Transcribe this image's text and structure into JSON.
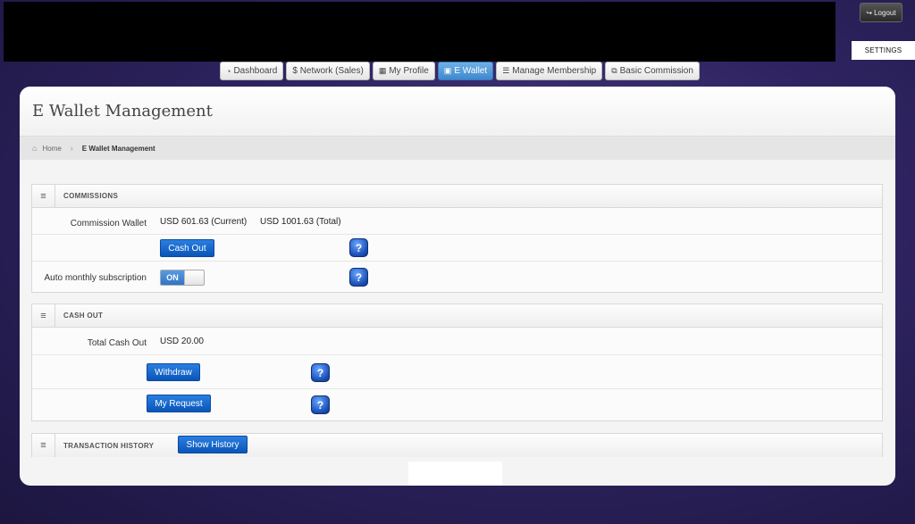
{
  "header": {
    "logout_label": "Logout",
    "settings_label": "SETTINGS"
  },
  "nav": {
    "tabs": [
      {
        "label": "Dashboard",
        "icon": "dashboard-icon"
      },
      {
        "label": "$ Network (Sales)",
        "icon": ""
      },
      {
        "label": "My Profile",
        "icon": "grid-icon"
      },
      {
        "label": "E Wallet",
        "icon": "wallet-icon",
        "active": true
      },
      {
        "label": "Manage Membership",
        "icon": "list-icon"
      },
      {
        "label": "Basic Commission",
        "icon": "external-link-icon"
      }
    ]
  },
  "page": {
    "title": "E Wallet Management",
    "breadcrumb": {
      "home": "Home",
      "current": "E Wallet Management"
    }
  },
  "commissions": {
    "title": "COMMISSIONS",
    "wallet_label": "Commission Wallet",
    "current_value": "USD 601.63 (Current)",
    "total_value": "USD 1001.63 (Total)",
    "cash_out_button": "Cash Out",
    "auto_sub_label": "Auto monthly subscription",
    "toggle_state": "ON",
    "help_label": "?"
  },
  "cashout": {
    "title": "CASH OUT",
    "total_label": "Total Cash Out",
    "total_value": "USD 20.00",
    "withdraw_button": "Withdraw",
    "request_button": "My Request",
    "help_label": "?"
  },
  "history": {
    "title": "TRANSACTION HISTORY",
    "show_button": "Show History"
  },
  "colors": {
    "accent_blue": "#0a55b8",
    "active_tab": "#3f88cf",
    "background": "#2e2360"
  }
}
